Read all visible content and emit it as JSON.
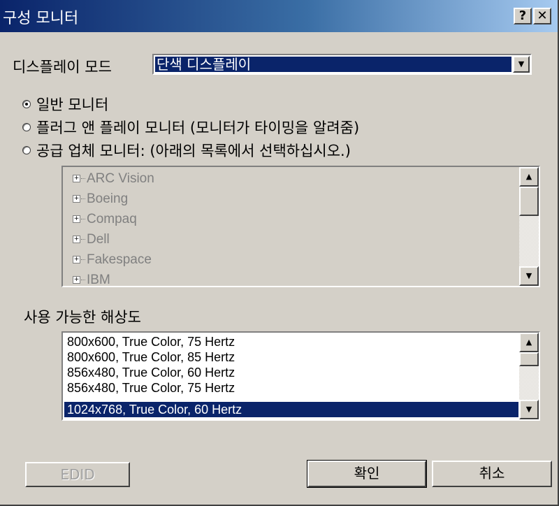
{
  "window": {
    "title": "구성 모니터",
    "help_glyph": "?",
    "close_glyph": "✕"
  },
  "display_mode": {
    "label": "디스플레이 모드",
    "value": "단색 디스플레이",
    "dropdown_arrow": "▼"
  },
  "monitor_options": [
    {
      "label": "일반 모니터",
      "checked": true
    },
    {
      "label": "플러그 앤 플레이 모니터 (모니터가 타이밍을 알려줌)",
      "checked": false
    },
    {
      "label": "공급 업체 모니터: (아래의 목록에서 선택하십시오.)",
      "checked": false
    }
  ],
  "vendor_list": {
    "items": [
      "ARC Vision",
      "Boeing",
      "Compaq",
      "Dell",
      "Fakespace",
      "IBM"
    ],
    "expand_glyph": "+"
  },
  "resolutions": {
    "label": "사용 가능한 해상도",
    "items": [
      "800x600, True Color, 75 Hertz",
      "800x600, True Color, 85 Hertz",
      "856x480, True Color, 60 Hertz",
      "856x480, True Color, 75 Hertz",
      "1024x768, True Color, 60 Hertz"
    ],
    "selected_index": 4
  },
  "scroll_glyphs": {
    "up": "▲",
    "down": "▼"
  },
  "buttons": {
    "edid": "EDID",
    "ok": "확인",
    "cancel": "취소"
  }
}
